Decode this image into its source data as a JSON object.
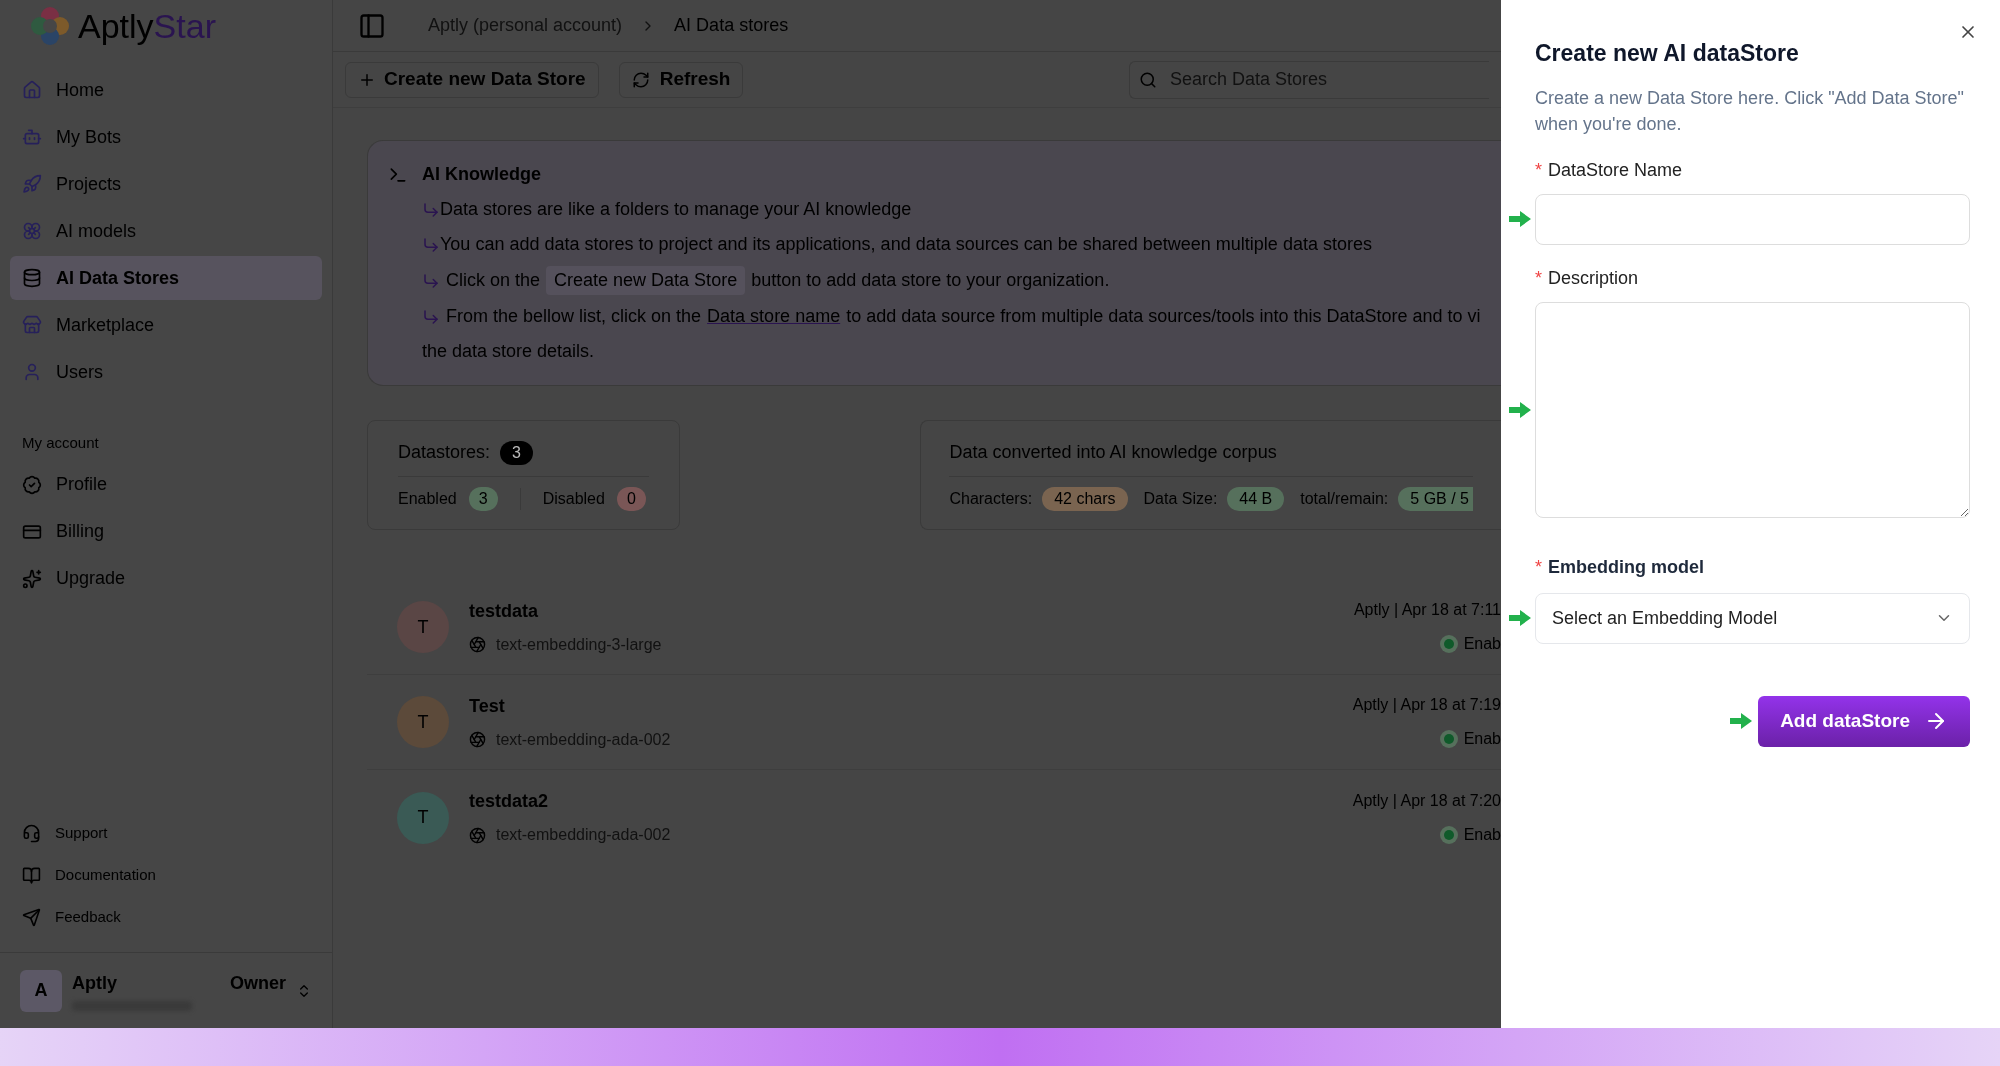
{
  "brand": {
    "name_1": "Aptly",
    "name_2": "Star"
  },
  "sidebar": {
    "items": [
      {
        "label": "Home",
        "selected": false
      },
      {
        "label": "My Bots",
        "selected": false
      },
      {
        "label": "Projects",
        "selected": false
      },
      {
        "label": "AI models",
        "selected": false
      },
      {
        "label": "AI Data Stores",
        "selected": true
      },
      {
        "label": "Marketplace",
        "selected": false
      },
      {
        "label": "Users",
        "selected": false
      }
    ],
    "section_title": "My account",
    "account_items": [
      "Profile",
      "Billing",
      "Upgrade"
    ],
    "footer_links": [
      "Support",
      "Documentation",
      "Feedback"
    ],
    "user": {
      "initial": "A",
      "name": "Aptly",
      "role": "Owner"
    }
  },
  "breadcrumb": [
    "Aptly (personal account)",
    "AI Data stores"
  ],
  "toolbar": {
    "create_button": "Create new Data Store",
    "refresh_button": "Refresh",
    "search_placeholder": "Search Data Stores"
  },
  "info_card": {
    "title": "AI Knowledge",
    "line_1": "Data stores are like a folders to manage your AI knowledge",
    "line_2": "You can add data stores to project and its applications, and data sources can be shared between multiple data stores",
    "line_3_before": "Click on the",
    "line_3_chip": "Create new Data Store",
    "line_3_after": "button to add data store to your organization.",
    "line_4_before": "From the bellow list, click on the",
    "line_4_link": "Data store name",
    "line_4_after": "to add data source from multiple data sources/tools into this DataStore and to vi",
    "line_5": "the data store details."
  },
  "stats": {
    "title": "Datastores:",
    "count": "3",
    "enabled_label": "Enabled",
    "enabled_count": "3",
    "disabled_label": "Disabled",
    "disabled_count": "0"
  },
  "corpus": {
    "title": "Data converted into AI knowledge corpus",
    "characters_label": "Characters:",
    "characters": "42 chars",
    "size_label": "Data Size:",
    "size": "44 B",
    "total_label": "total/remain:",
    "total": "5 GB / 5"
  },
  "datastores": [
    {
      "initial": "T",
      "name": "testdata",
      "model": "text-embedding-3-large",
      "meta": "Aptly | Apr 18 at 7:11",
      "status": "Enab",
      "color": "#5a4645"
    },
    {
      "initial": "T",
      "name": "Test",
      "model": "text-embedding-ada-002",
      "meta": "Aptly | Apr 18 at 7:19",
      "status": "Enab",
      "color": "#5c4a3a"
    },
    {
      "initial": "T",
      "name": "testdata2",
      "model": "text-embedding-ada-002",
      "meta": "Aptly | Apr 18 at 7:20",
      "status": "Enab",
      "color": "#3a5a55"
    }
  ],
  "drawer": {
    "title": "Create new AI dataStore",
    "subtitle": "Create a new Data Store here. Click \"Add Data Store\" when you're done.",
    "required_mark": "*",
    "name_label": "DataStore Name",
    "description_label": "Description",
    "model_label": "Embedding model",
    "model_placeholder": "Select an Embedding Model",
    "submit": "Add dataStore"
  }
}
